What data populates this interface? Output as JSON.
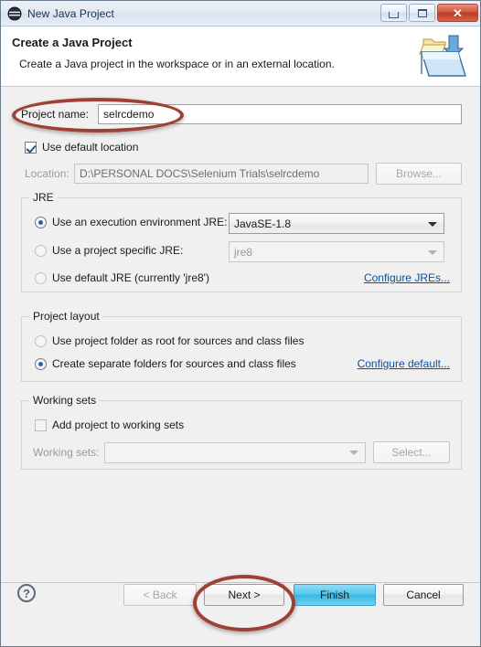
{
  "window": {
    "title": "New Java Project",
    "icon": "eclipse-sphere-icon",
    "minimize_label": "Minimize",
    "maximize_label": "Maximize",
    "close_label": "Close"
  },
  "header": {
    "title": "Create a Java Project",
    "subtitle": "Create a Java project in the workspace or in an external location.",
    "art_icon": "new-java-project-folder-icon"
  },
  "project": {
    "name_label": "Project name:",
    "name_value": "selrcdemo",
    "use_default_location_label": "Use default location",
    "use_default_location_checked": true,
    "location_label": "Location:",
    "location_value": "D:\\PERSONAL DOCS\\Selenium Trials\\selrcdemo",
    "browse_label": "Browse..."
  },
  "jre": {
    "group_title": "JRE",
    "options": [
      {
        "label": "Use an execution environment JRE:",
        "selected": true
      },
      {
        "label": "Use a project specific JRE:",
        "selected": false
      },
      {
        "label": "Use default JRE (currently 'jre8')",
        "selected": false
      }
    ],
    "execution_env_value": "JavaSE-1.8",
    "project_jre_value": "jre8",
    "configure_link": "Configure JREs..."
  },
  "layout": {
    "group_title": "Project layout",
    "options": [
      {
        "label": "Use project folder as root for sources and class files",
        "selected": false
      },
      {
        "label": "Create separate folders for sources and class files",
        "selected": true
      }
    ],
    "configure_link": "Configure default..."
  },
  "working_sets": {
    "group_title": "Working sets",
    "add_label": "Add project to working sets",
    "add_checked": false,
    "sets_label": "Working sets:",
    "sets_value": "",
    "select_label": "Select..."
  },
  "footer": {
    "help_glyph": "?",
    "back_label": "< Back",
    "next_label": "Next >",
    "finish_label": "Finish",
    "cancel_label": "Cancel"
  },
  "annotations": {
    "color": "#9e4034",
    "targets": [
      "project-name-field",
      "next-button"
    ]
  }
}
